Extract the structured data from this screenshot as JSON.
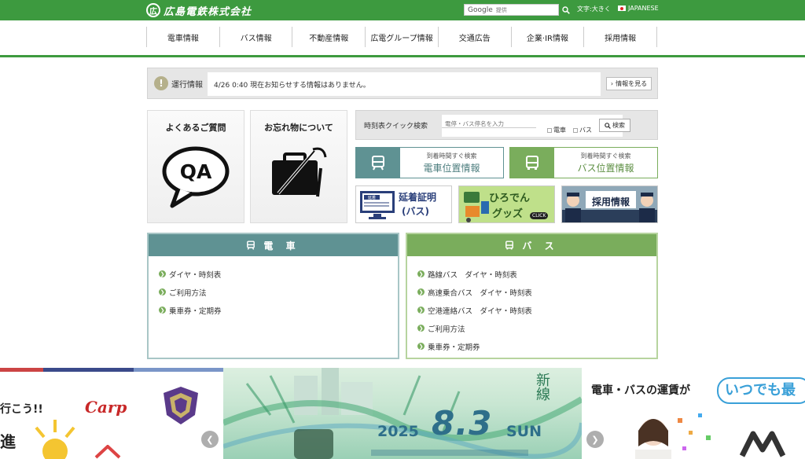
{
  "header": {
    "logo_mark": "広",
    "logo_text": "広島電鉄株式会社",
    "search_brand": "Google",
    "search_placeholder": "提供",
    "text_size": "文字:大きく",
    "language": "JAPANESE"
  },
  "nav": {
    "items": [
      "電車情報",
      "バス情報",
      "不動産情報",
      "広電グループ情報",
      "交通広告",
      "企業·IR情報",
      "採用情報"
    ]
  },
  "operation": {
    "label": "運行情報",
    "message": "4/26 0:40 現在お知らせする情報はありません。",
    "more": "情報を見る"
  },
  "cards": {
    "faq": "よくあるご質問",
    "faq_icon_text": "QA",
    "lost": "お忘れ物について"
  },
  "timetable": {
    "label": "時刻表クイック検索",
    "placeholder": "電停・バス停名を入力",
    "opt_train": "電車",
    "opt_bus": "バス",
    "search": "検索"
  },
  "locations": {
    "train_sub": "到着時間すぐ検索",
    "train_main": "電車位置情報",
    "bus_sub": "到着時間すぐ検索",
    "bus_main": "バス位置情報"
  },
  "banners": {
    "delay_tag": "延着",
    "delay_line1": "延着証明",
    "delay_line2": "(バス)",
    "goods_line1": "ひろでん",
    "goods_line2": "グッズ",
    "goods_click": "CLICK",
    "recruit": "採用情報"
  },
  "train": {
    "title": "電 車",
    "links": [
      "ダイヤ・時刻表",
      "ご利用方法",
      "乗車券・定期券"
    ]
  },
  "bus": {
    "title": "バ ス",
    "links": [
      "路線バス　ダイヤ・時刻表",
      "高速乗合バス　ダイヤ・時刻表",
      "空港連絡バス　ダイヤ・時刻表",
      "ご利用方法",
      "乗車券・定期券"
    ]
  },
  "slides": {
    "s1_text1": "行こう!!",
    "s1_text2": "進",
    "s1_carp": "Carp",
    "s2_year": "2025",
    "s2_date": "8.3",
    "s2_day": "SUN",
    "s2_script": "新線",
    "s3_text1": "電車・バスの運賃が",
    "s3_text2": "いつでも最"
  },
  "colors": {
    "brand_green": "#3d9a3f",
    "train_teal": "#5f9293",
    "bus_green": "#7aad5c"
  }
}
